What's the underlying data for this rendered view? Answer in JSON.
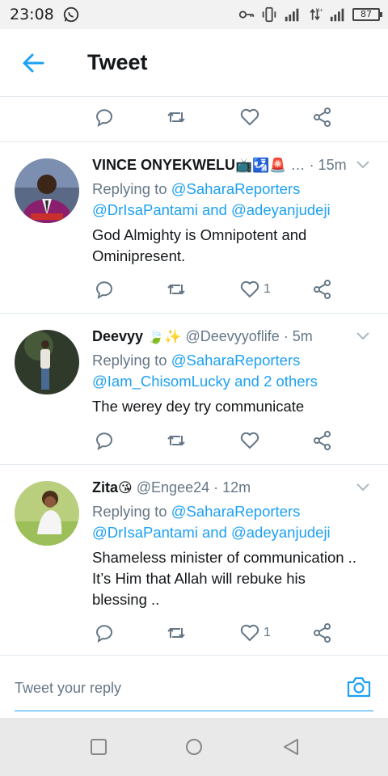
{
  "status_bar": {
    "time": "23:08",
    "battery": "87",
    "network": "H+",
    "icons": [
      "whatsapp-icon",
      "key-icon",
      "vibrate-icon",
      "signal-icon",
      "data-arrows-icon",
      "signal-icon",
      "battery-icon"
    ]
  },
  "header": {
    "title": "Tweet",
    "back_icon": "arrow-left-icon"
  },
  "colors": {
    "accent": "#1da1f2",
    "secondary_text": "#657786",
    "divider": "#e1e8ed"
  },
  "tweets": [
    {
      "name": "VINCE ONYEKWELU",
      "name_emoji": "📺🛂🚨",
      "handle": "…",
      "time": "· 15m",
      "replying_prefix": "Replying to ",
      "replying_to_1": "@SaharaReporters",
      "replying_to_2": "@DrIsaPantami and @adeyanjudeji",
      "text_1": "God Almighty is Omnipotent and",
      "text_2": "Ominipresent.",
      "likes": "1"
    },
    {
      "name": "Deevyy",
      "name_emoji": "🍃✨",
      "handle": "@Deevyyoflife",
      "time": "· 5m",
      "replying_prefix": "Replying to ",
      "replying_to_1": "@SaharaReporters",
      "replying_to_2": "@Iam_ChisomLucky and 2 others",
      "text_1": "The werey dey try communicate",
      "likes": ""
    },
    {
      "name": "Zita",
      "name_emoji": "😘",
      "handle": "@Engee24",
      "time": "· 12m",
      "replying_prefix": "Replying to ",
      "replying_to_1": "@SaharaReporters",
      "replying_to_2": "@DrIsaPantami and @adeyanjudeji",
      "text_1": "Shameless minister of communication ..",
      "text_2": "It’s Him that Allah will rebuke his",
      "text_3": "blessing ..",
      "likes": "1"
    }
  ],
  "reply_box": {
    "placeholder": "Tweet your reply",
    "camera_icon": "camera-icon"
  },
  "nav_bar": {
    "icons": [
      "recents-square-icon",
      "home-circle-icon",
      "back-triangle-icon"
    ]
  }
}
